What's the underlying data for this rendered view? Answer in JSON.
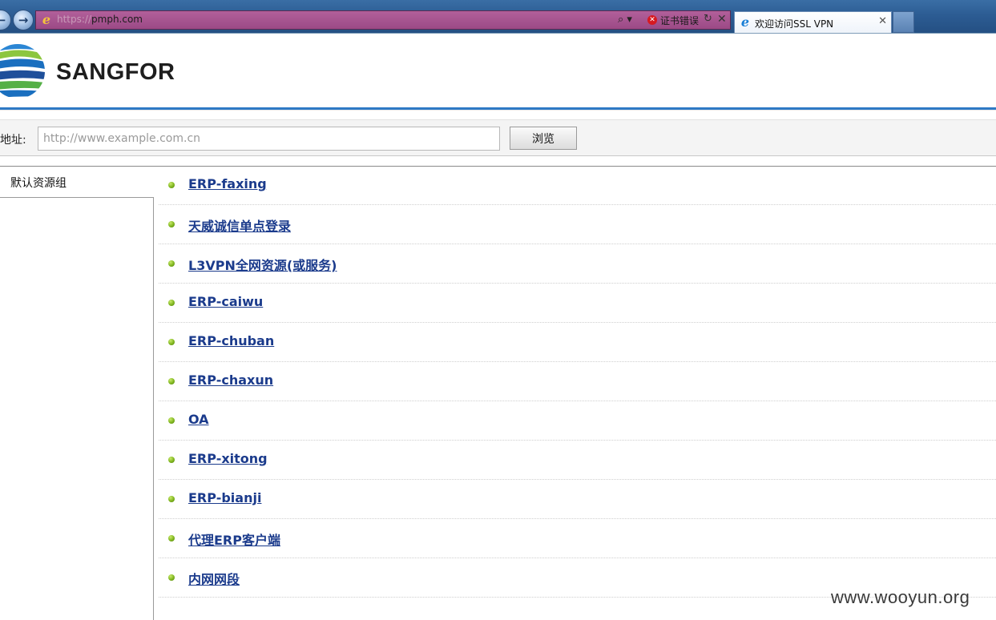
{
  "browser": {
    "url_prefix": "https://",
    "url_host": "pmph.com",
    "url_path": "",
    "cert_error": "证书错误",
    "tab_title": "欢迎访问SSL VPN",
    "search_glyph": "⌕ ▾",
    "refresh_glyph": "↻",
    "stop_glyph": "✕",
    "close_glyph": "✕",
    "back_glyph": "←",
    "forward_glyph": "→",
    "ie_glyph": "e",
    "cert_glyph": "✕"
  },
  "header": {
    "brand": "SANGFOR"
  },
  "browse": {
    "label": "地址:",
    "placeholder": "http://www.example.com.cn",
    "value": "",
    "button": "浏览"
  },
  "sidebar": {
    "group": "默认资源组"
  },
  "resources": [
    "ERP-faxing",
    "天威诚信单点登录",
    "L3VPN全网资源(或服务)",
    "ERP-caiwu",
    "ERP-chuban",
    "ERP-chaxun",
    "OA",
    "ERP-xitong",
    "ERP-bianji",
    "代理ERP客户端",
    "内网网段"
  ],
  "watermark": "www.wooyun.org",
  "colors": {
    "link": "#1b3b8c",
    "header_rule": "#2e79c5",
    "bullet": "#7fb51f",
    "address_bar_error": "#9c4a86"
  }
}
